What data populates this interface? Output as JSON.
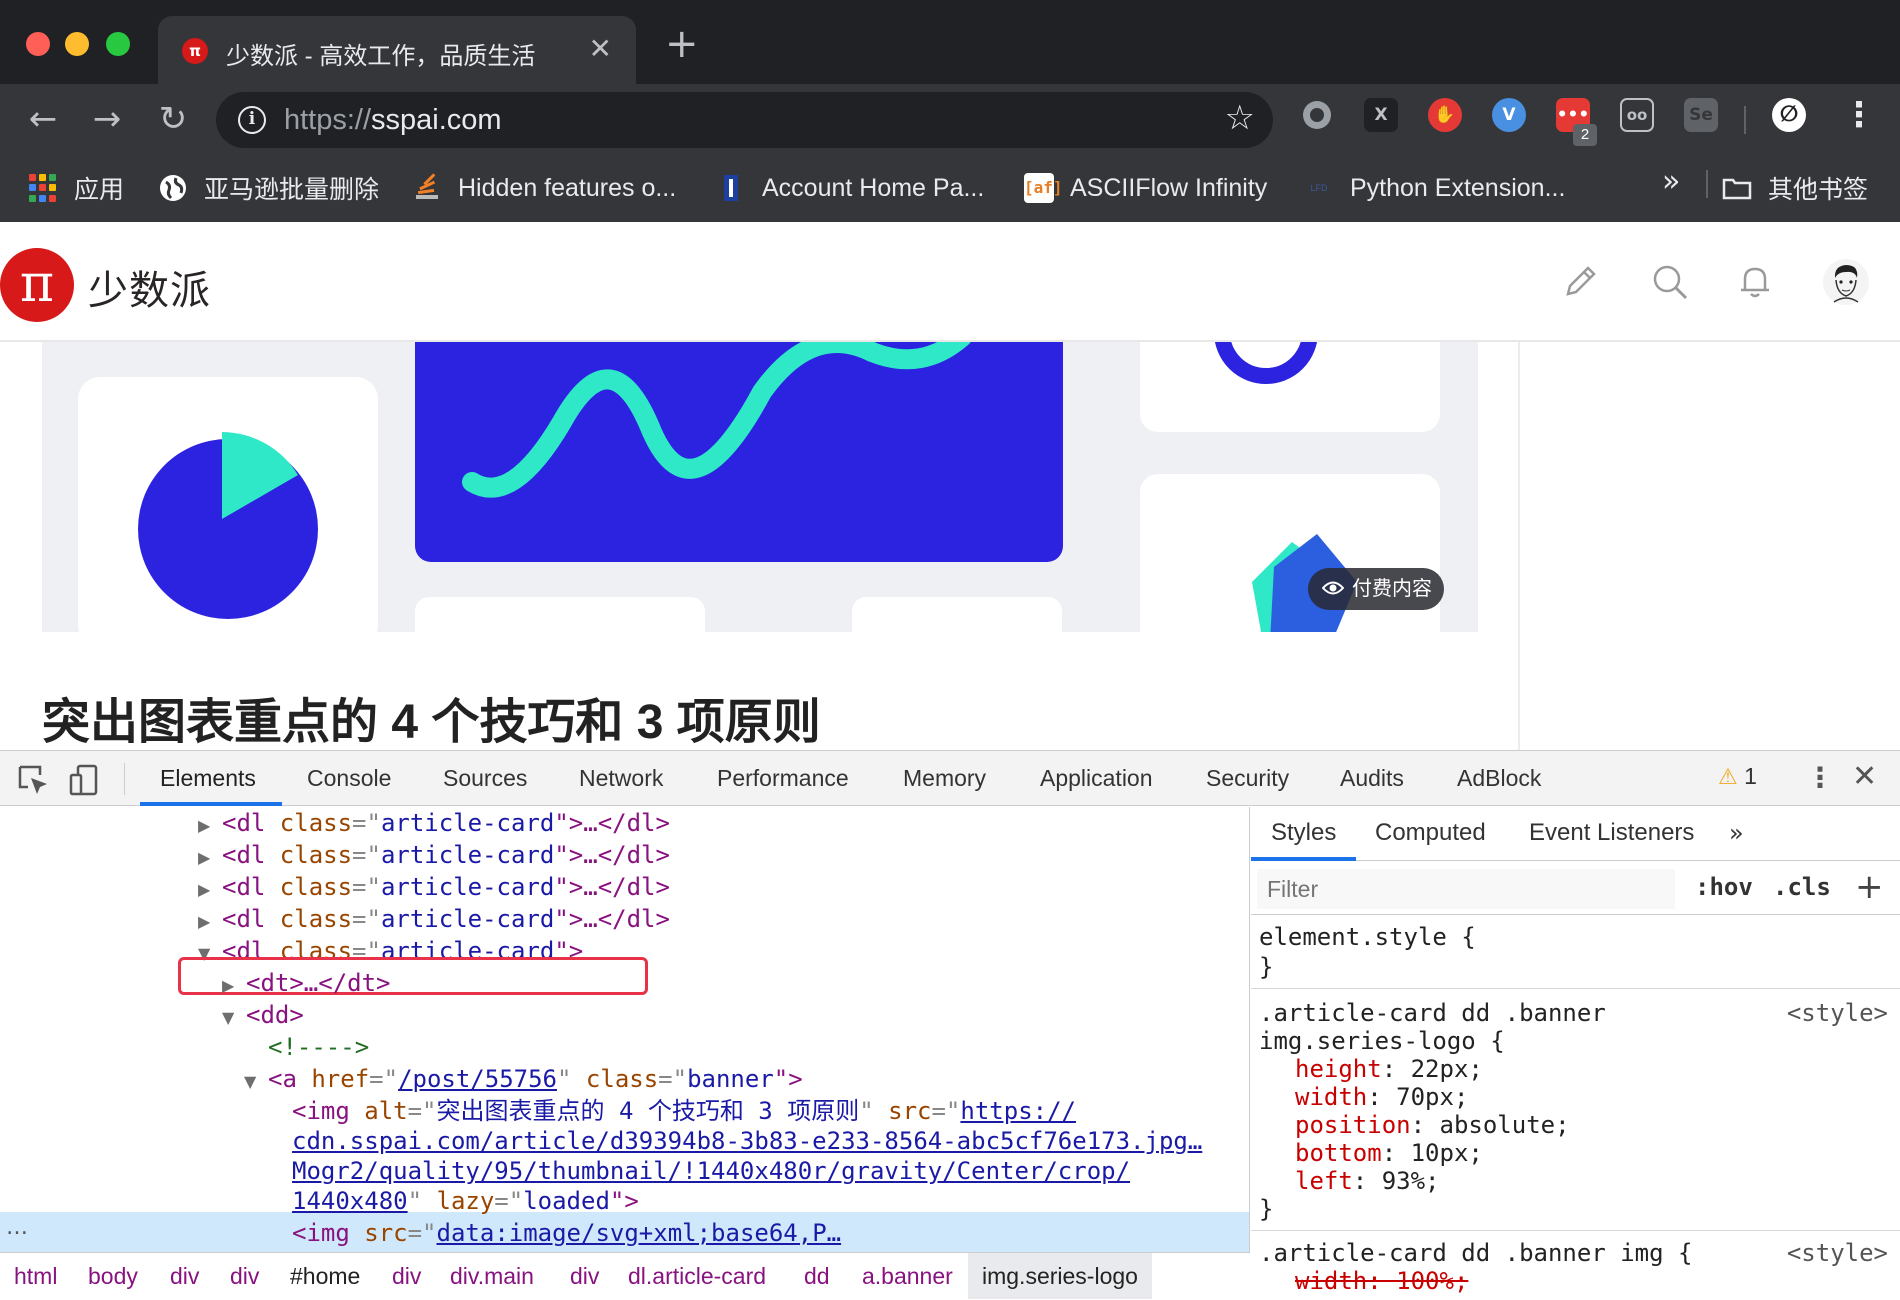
{
  "browser": {
    "tab": {
      "favicon": "π",
      "title": "少数派 - 高效工作，品质生活",
      "close": "✕"
    },
    "new_tab": "+",
    "nav": {
      "back": "←",
      "forward": "→",
      "reload": "↻"
    },
    "address": {
      "info": "i",
      "protocol": "https://",
      "host": "sspai.com",
      "bookmark_star": "☆"
    },
    "extensions": [
      {
        "name": "record-extension",
        "label": "",
        "color": "#9aa0a6"
      },
      {
        "name": "x-extension",
        "label": "X",
        "color": "#202124"
      },
      {
        "name": "adblock-extension",
        "label": "✋",
        "color": "#e53935"
      },
      {
        "name": "v-extension",
        "label": "V",
        "color": "#4a90e2"
      },
      {
        "name": "red-counter-extension",
        "label": "•••",
        "color": "#e53935"
      },
      {
        "name": "glasses-extension",
        "label": "oo",
        "color": "#35363a"
      },
      {
        "name": "se-extension",
        "label": "Se",
        "color": "#5f6368"
      },
      {
        "name": "profile-extension",
        "label": "∅",
        "color": "#fff"
      }
    ],
    "extension_badge": "2",
    "menu": "⋮",
    "bookmarks": [
      {
        "label": "应用",
        "icon": "apps-grid-icon"
      },
      {
        "label": "亚马逊批量删除",
        "icon": "globe-icon"
      },
      {
        "label": "Hidden features o...",
        "icon": "stack-icon"
      },
      {
        "label": "Account Home Pa...",
        "icon": "bank-icon"
      },
      {
        "label": "ASCIIFlow Infinity",
        "icon": "af-icon"
      },
      {
        "label": "Python Extension...",
        "icon": "lfd-icon"
      }
    ],
    "bookmarks_more": "»",
    "other_bookmarks": "其他书签"
  },
  "page": {
    "logo_mark": "π",
    "logo_text": "少数派",
    "header_icons": [
      "pencil-icon",
      "search-icon",
      "bell-icon",
      "avatar"
    ],
    "paid_badge": "付费内容",
    "article_title": "突出图表重点的 4 个技巧和 3 项原则"
  },
  "devtools": {
    "tabs": [
      "Elements",
      "Console",
      "Sources",
      "Network",
      "Performance",
      "Memory",
      "Application",
      "Security",
      "Audits",
      "AdBlock"
    ],
    "active_tab": "Elements",
    "warning_count": "1",
    "warning_icon": "⚠",
    "menu": "⋮",
    "close": "✕",
    "dom": {
      "collapsed_card": {
        "open": "<dl ",
        "attr": "class",
        "eq": "=\"",
        "val": "article-card",
        "close": "\">…</dl>"
      },
      "open_card": {
        "open": "<dl ",
        "attr": "class",
        "eq": "=\"",
        "val": "article-card",
        "close": "\">"
      },
      "dt": "<dt>…</dt>",
      "dd": "<dd>",
      "comment": "<!---->",
      "a": {
        "open": "<a ",
        "href_attr": "href",
        "href": "/post/55756",
        "class_attr": "class",
        "class": "banner",
        "close": "\">"
      },
      "img1": {
        "open": "<img ",
        "alt_attr": "alt",
        "alt": "突出图表重点的 4 个技巧和 3 项原则",
        "src_attr": "src",
        "src_1": "https://",
        "src_2": "cdn.sspai.com/article/d39394b8-3b83-e233-8564-abc5cf76e173.jpg…",
        "src_3": "Mogr2/quality/95/thumbnail/!1440x480r/gravity/Center/crop/",
        "src_4": "1440x480",
        "lazy_attr": "lazy",
        "lazy": "loaded",
        "close": "\">"
      },
      "img2": {
        "open": "<img ",
        "src_attr": "src",
        "src": "data:image/svg+xml;base64,P…"
      },
      "selected_dots": "…"
    },
    "breadcrumbs": [
      "html",
      "body",
      "div",
      "div",
      "#home",
      "div",
      "div.main",
      "div",
      "dl.article-card",
      "dd",
      "a.banner",
      "img.series-logo"
    ],
    "styles_panel": {
      "tabs": [
        "Styles",
        "Computed",
        "Event Listeners",
        "»"
      ],
      "filter_placeholder": "Filter",
      "hov": ":hov",
      "cls": ".cls",
      "add": "+",
      "element_style": "element.style {",
      "close_brace": "}",
      "rule1": {
        "selector_1": ".article-card dd .banner",
        "selector_2": "img.series-logo {",
        "source": "<style>",
        "props": [
          {
            "name": "height",
            "value": "22px;"
          },
          {
            "name": "width",
            "value": "70px;"
          },
          {
            "name": "position",
            "value": "absolute;"
          },
          {
            "name": "bottom",
            "value": "10px;"
          },
          {
            "name": "left",
            "value": "93%;"
          }
        ]
      },
      "rule2": {
        "selector": ".article-card dd .banner img {",
        "source": "<style>",
        "struck_prop": "width: 100%;"
      }
    }
  }
}
